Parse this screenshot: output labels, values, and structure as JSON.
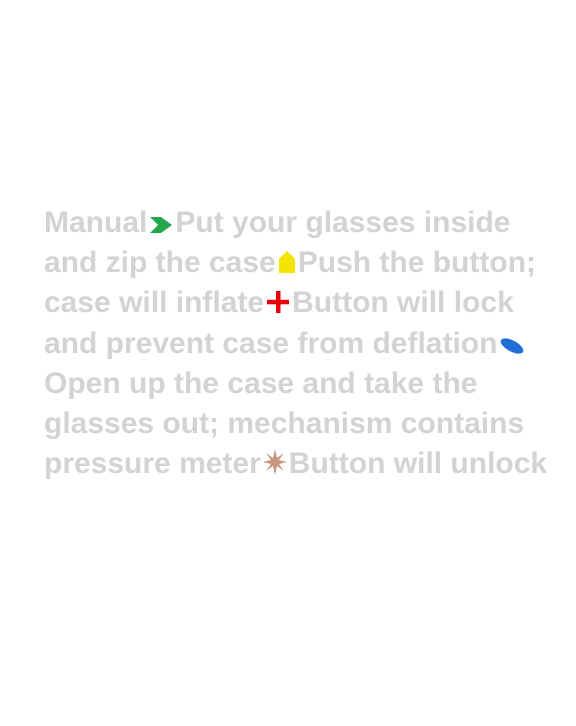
{
  "segments": [
    "Manual",
    "Put your glasses inside and zip the case",
    "Push the button; case will inflate",
    "Button will lock and prevent case from deflation",
    "Open up the case and take the glasses out; mechanism contains pressure meter",
    "Button will unlock"
  ],
  "icons": {
    "arrow": {
      "name": "chevron-right-icon",
      "color": "#22a84a"
    },
    "house": {
      "name": "house-shape-icon",
      "color": "#f5e400"
    },
    "plus": {
      "name": "plus-icon",
      "color": "#e8000b"
    },
    "ellipse": {
      "name": "ellipse-icon",
      "color": "#1f6fd6"
    },
    "star": {
      "name": "star-burst-icon",
      "color": "#c8957d"
    }
  }
}
